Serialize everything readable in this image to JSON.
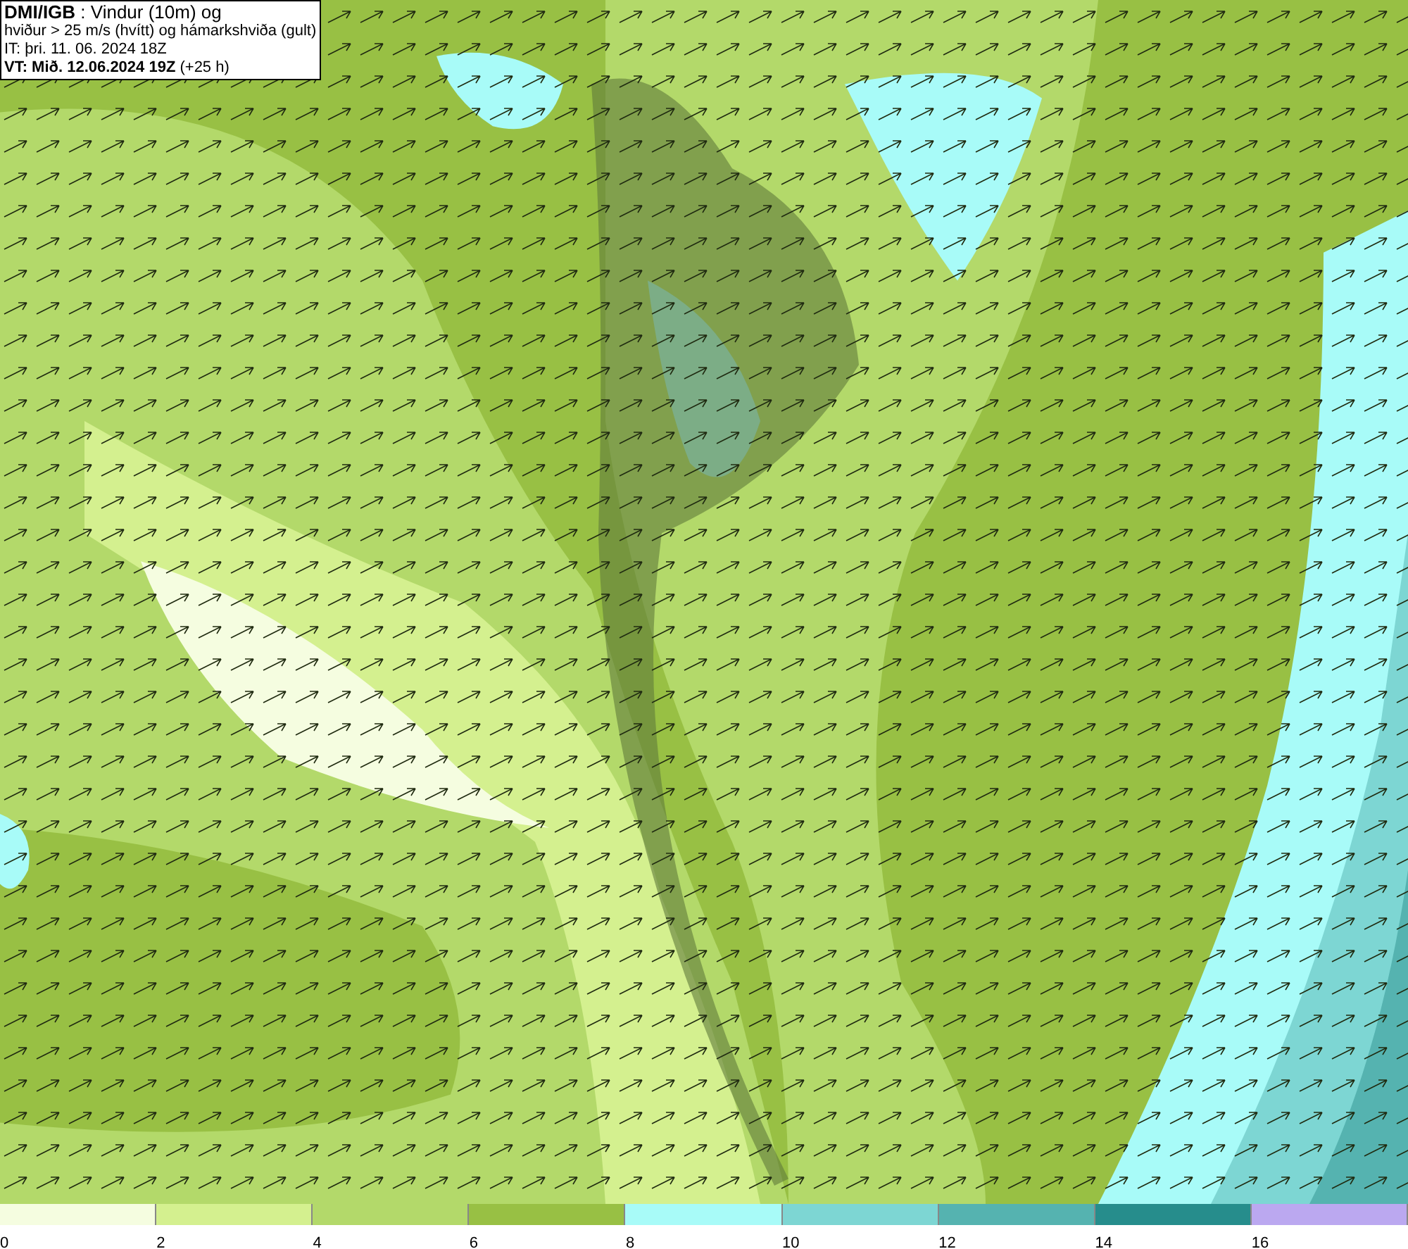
{
  "info_box": {
    "lines": [
      "**DMI/IGB** : Vindur (10m) og",
      "hviður > 25 m/s (hvítt) og hámarkshviða (gult)",
      "IT: þri. 11. 06. 2024 18Z",
      "**VT: Mið. 12.06.2024 19Z** (+25 h)"
    ]
  },
  "legend": [
    {
      "label": "0",
      "color": "#f5fde0"
    },
    {
      "label": "2",
      "color": "#d4f08f"
    },
    {
      "label": "4",
      "color": "#b3d96a"
    },
    {
      "label": "6",
      "color": "#98c044"
    },
    {
      "label": "8",
      "color": "#a8fbf8"
    },
    {
      "label": "10",
      "color": "#7dd6d3"
    },
    {
      "label": "12",
      "color": "#55b3b0"
    },
    {
      "label": "14",
      "color": "#268d8c"
    },
    {
      "label": "16",
      "color": "#bba8f0"
    }
  ]
}
